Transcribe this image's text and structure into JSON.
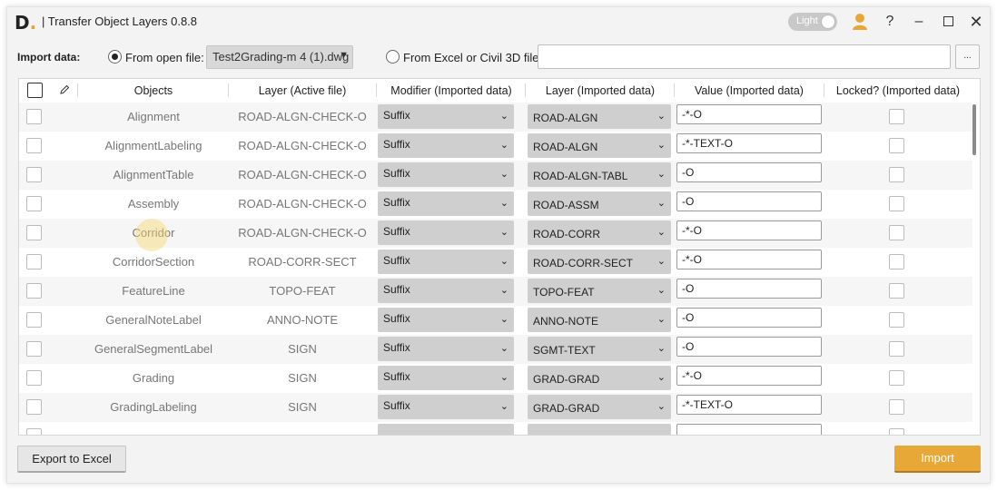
{
  "window": {
    "title": "| Transfer Object Layers 0.8.8",
    "logo": "D",
    "theme_label": "Light"
  },
  "import": {
    "label": "Import data:",
    "option_open_file": "From open file:",
    "open_file_value": "Test2Grading-m 4 (1).dwg",
    "option_excel": "From Excel or Civil 3D file:",
    "browse_label": "..."
  },
  "grid": {
    "headers": {
      "objects": "Objects",
      "layer_active": "Layer (Active file)",
      "modifier": "Modifier (Imported data)",
      "layer_imported": "Layer (Imported data)",
      "value": "Value (Imported data)",
      "locked": "Locked? (Imported data)"
    },
    "rows": [
      {
        "object": "Alignment",
        "layer_active": "ROAD-ALGN-CHECK-O",
        "modifier": "Suffix",
        "layer_imported": "ROAD-ALGN",
        "value": "-*-O"
      },
      {
        "object": "AlignmentLabeling",
        "layer_active": "ROAD-ALGN-CHECK-O",
        "modifier": "Suffix",
        "layer_imported": "ROAD-ALGN",
        "value": "-*-TEXT-O"
      },
      {
        "object": "AlignmentTable",
        "layer_active": "ROAD-ALGN-CHECK-O",
        "modifier": "Suffix",
        "layer_imported": "ROAD-ALGN-TABL",
        "value": "-O"
      },
      {
        "object": "Assembly",
        "layer_active": "ROAD-ALGN-CHECK-O",
        "modifier": "Suffix",
        "layer_imported": "ROAD-ASSM",
        "value": "-O"
      },
      {
        "object": "Corridor",
        "layer_active": "ROAD-ALGN-CHECK-O",
        "modifier": "Suffix",
        "layer_imported": "ROAD-CORR",
        "value": "-*-O"
      },
      {
        "object": "CorridorSection",
        "layer_active": "ROAD-CORR-SECT",
        "modifier": "Suffix",
        "layer_imported": "ROAD-CORR-SECT",
        "value": "-*-O"
      },
      {
        "object": "FeatureLine",
        "layer_active": "TOPO-FEAT",
        "modifier": "Suffix",
        "layer_imported": "TOPO-FEAT",
        "value": "-O"
      },
      {
        "object": "GeneralNoteLabel",
        "layer_active": "ANNO-NOTE",
        "modifier": "Suffix",
        "layer_imported": "ANNO-NOTE",
        "value": "-O"
      },
      {
        "object": "GeneralSegmentLabel",
        "layer_active": "SIGN",
        "modifier": "Suffix",
        "layer_imported": "SGMT-TEXT",
        "value": "-O"
      },
      {
        "object": "Grading",
        "layer_active": "SIGN",
        "modifier": "Suffix",
        "layer_imported": "GRAD-GRAD",
        "value": "-*-O"
      },
      {
        "object": "GradingLabeling",
        "layer_active": "SIGN",
        "modifier": "Suffix",
        "layer_imported": "GRAD-GRAD",
        "value": "-*-TEXT-O"
      }
    ]
  },
  "footer": {
    "export_label": "Export to Excel",
    "import_label": "Import"
  },
  "colors": {
    "accent": "#e8a838",
    "window_bg": "#f3f3f3",
    "dropdown_bg": "#cfcfcf"
  }
}
